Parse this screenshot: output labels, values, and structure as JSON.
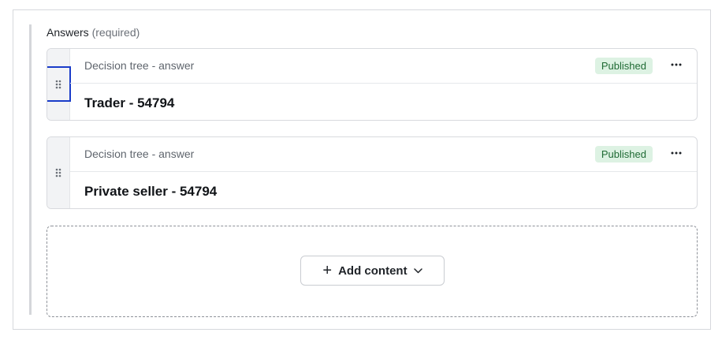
{
  "answers_field": {
    "label": "Answers",
    "required_note": "(required)"
  },
  "cards": [
    {
      "type_label": "Decision tree - answer",
      "status": "Published",
      "title": "Trader - 54794",
      "focused_handle": true
    },
    {
      "type_label": "Decision tree - answer",
      "status": "Published",
      "title": "Private seller - 54794",
      "focused_handle": false
    }
  ],
  "add_content": {
    "label": "Add content",
    "plus_icon": "plus-icon",
    "chevron_icon": "chevron-down-icon"
  },
  "icons": {
    "drag": "drag-handle-icon",
    "more": "more-options-icon"
  },
  "colors": {
    "status_badge_bg": "#ddf2e3",
    "status_badge_text": "#1f6a34",
    "focus_outline": "#1a3cc9"
  }
}
